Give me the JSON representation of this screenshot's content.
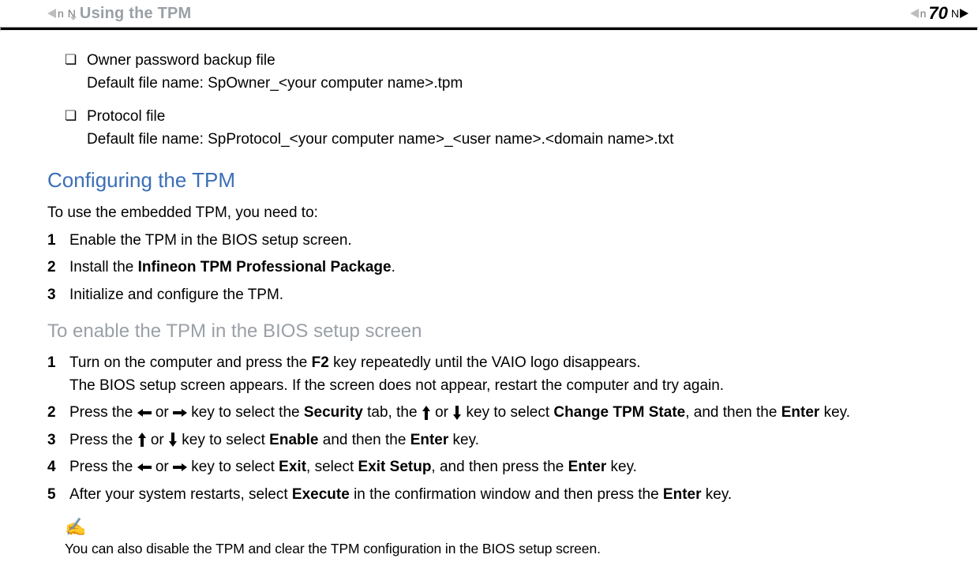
{
  "header": {
    "breadcrumb": "Using the TPM",
    "page_number": "70"
  },
  "bullets": [
    {
      "title": "Owner password backup file",
      "sub": "Default file name: SpOwner_<your computer name>.tpm"
    },
    {
      "title": "Protocol file",
      "sub": "Default file name: SpProtocol_<your computer name>_<user name>.<domain name>.txt"
    }
  ],
  "section_configure": {
    "heading": "Configuring the TPM",
    "intro": "To use the embedded TPM, you need to:",
    "steps": [
      {
        "plain": "Enable the TPM in the BIOS setup screen."
      },
      {
        "pre": "Install the ",
        "bold": "Infineon TPM Professional Package",
        "post": "."
      },
      {
        "plain": "Initialize and configure the TPM."
      }
    ]
  },
  "section_enable": {
    "heading": "To enable the TPM in the BIOS setup screen",
    "steps": {
      "s1": {
        "p1a": "Turn on the computer and press the ",
        "p1b": "F2",
        "p1c": " key repeatedly until the VAIO logo disappears.",
        "p2": "The BIOS setup screen appears. If the screen does not appear, restart the computer and try again."
      },
      "s2": {
        "a": "Press the ",
        "b": " or ",
        "c": " key to select the ",
        "d": "Security",
        "e": " tab, the ",
        "f": " or ",
        "g": " key to select ",
        "h": "Change TPM State",
        "i": ", and then the ",
        "j": "Enter",
        "k": " key."
      },
      "s3": {
        "a": "Press the ",
        "b": " or ",
        "c": " key to select ",
        "d": "Enable",
        "e": " and then the ",
        "f": "Enter",
        "g": " key."
      },
      "s4": {
        "a": "Press the ",
        "b": " or ",
        "c": " key to select ",
        "d": "Exit",
        "e": ", select ",
        "f": "Exit Setup",
        "g": ", and then press the ",
        "h": "Enter",
        "i": " key."
      },
      "s5": {
        "a": "After your system restarts, select ",
        "b": "Execute",
        "c": " in the confirmation window and then press the ",
        "d": "Enter",
        "e": " key."
      }
    }
  },
  "note": {
    "icon": "✍",
    "text": "You can also disable the TPM and clear the TPM configuration in the BIOS setup screen."
  }
}
